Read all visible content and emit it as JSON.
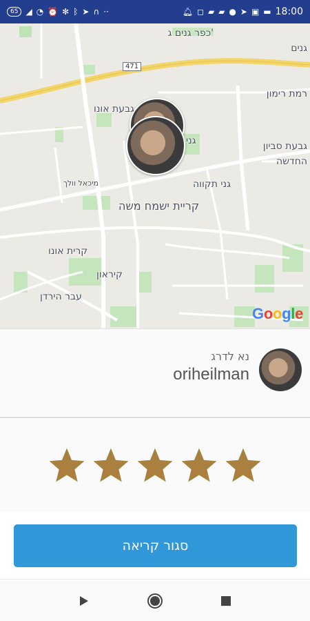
{
  "status_bar": {
    "left_badge": "65",
    "time": "18:00",
    "left_icons": [
      "signal-icon",
      "wifi-icon",
      "alarm-icon",
      "sync-off-icon",
      "bluetooth-icon",
      "location-icon",
      "headphones-icon",
      "more-dots-icon"
    ],
    "right_icons": [
      "notification-icon",
      "instagram-icon",
      "app-icon",
      "app-icon-2",
      "waze-icon",
      "telegram-icon",
      "app-icon-3",
      "message-icon"
    ]
  },
  "map": {
    "labels": [
      "כפר גנים ג'",
      "גנים",
      "רמת רימון",
      "גבעת אונו",
      "גני",
      "גבעת סביון",
      "החדשה",
      "גני תקווה",
      "קריית ישמח משה",
      "קרית אונו",
      "קיראון",
      "עבר הירדן",
      "מיכאל וולך",
      "471"
    ],
    "attribution": "Google",
    "attribution_colors": [
      "#4285f4",
      "#ea4335",
      "#fbbc05",
      "#4285f4",
      "#34a853",
      "#ea4335"
    ]
  },
  "driver": {
    "status": "נא לדרג",
    "name": "oriheilman"
  },
  "rating": {
    "stars": 5,
    "max": 5,
    "star_color": "#a9803e"
  },
  "action": {
    "close_label": "סגור קריאה",
    "button_color": "#3098d8"
  },
  "nav": {
    "icons": [
      "back-triangle-icon",
      "home-circle-icon",
      "recents-square-icon"
    ]
  }
}
